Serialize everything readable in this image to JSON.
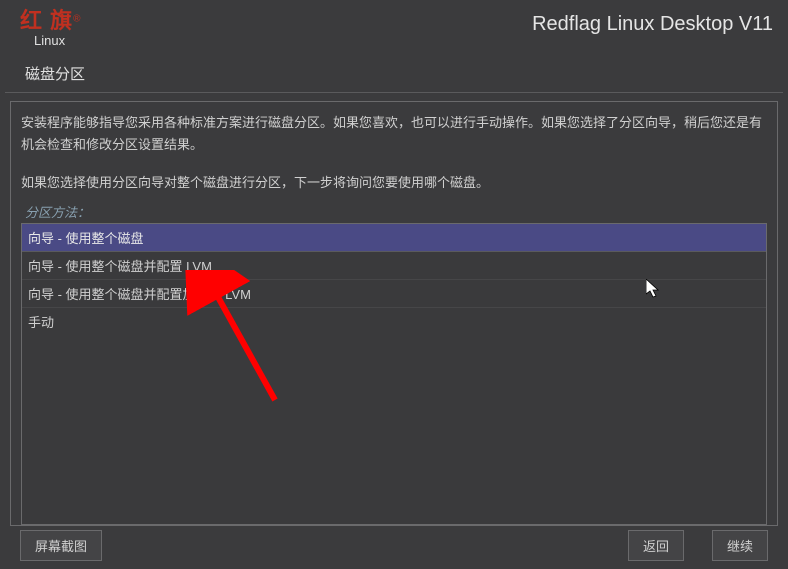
{
  "header": {
    "logo_main": "红 旗",
    "logo_sub": "Linux",
    "title": "Redflag Linux Desktop V11"
  },
  "section": {
    "title": "磁盘分区"
  },
  "content": {
    "desc1": "安装程序能够指导您采用各种标准方案进行磁盘分区。如果您喜欢，也可以进行手动操作。如果您选择了分区向导，稍后您还是有机会检查和修改分区设置结果。",
    "desc2": "如果您选择使用分区向导对整个磁盘进行分区，下一步将询问您要使用哪个磁盘。",
    "method_label": "分区方法："
  },
  "options": [
    {
      "label": "向导 - 使用整个磁盘",
      "selected": true
    },
    {
      "label": "向导 - 使用整个磁盘并配置 LVM",
      "selected": false
    },
    {
      "label": "向导 - 使用整个磁盘并配置加密的 LVM",
      "selected": false
    },
    {
      "label": "手动",
      "selected": false
    }
  ],
  "footer": {
    "screenshot": "屏幕截图",
    "back": "返回",
    "continue": "继续"
  }
}
